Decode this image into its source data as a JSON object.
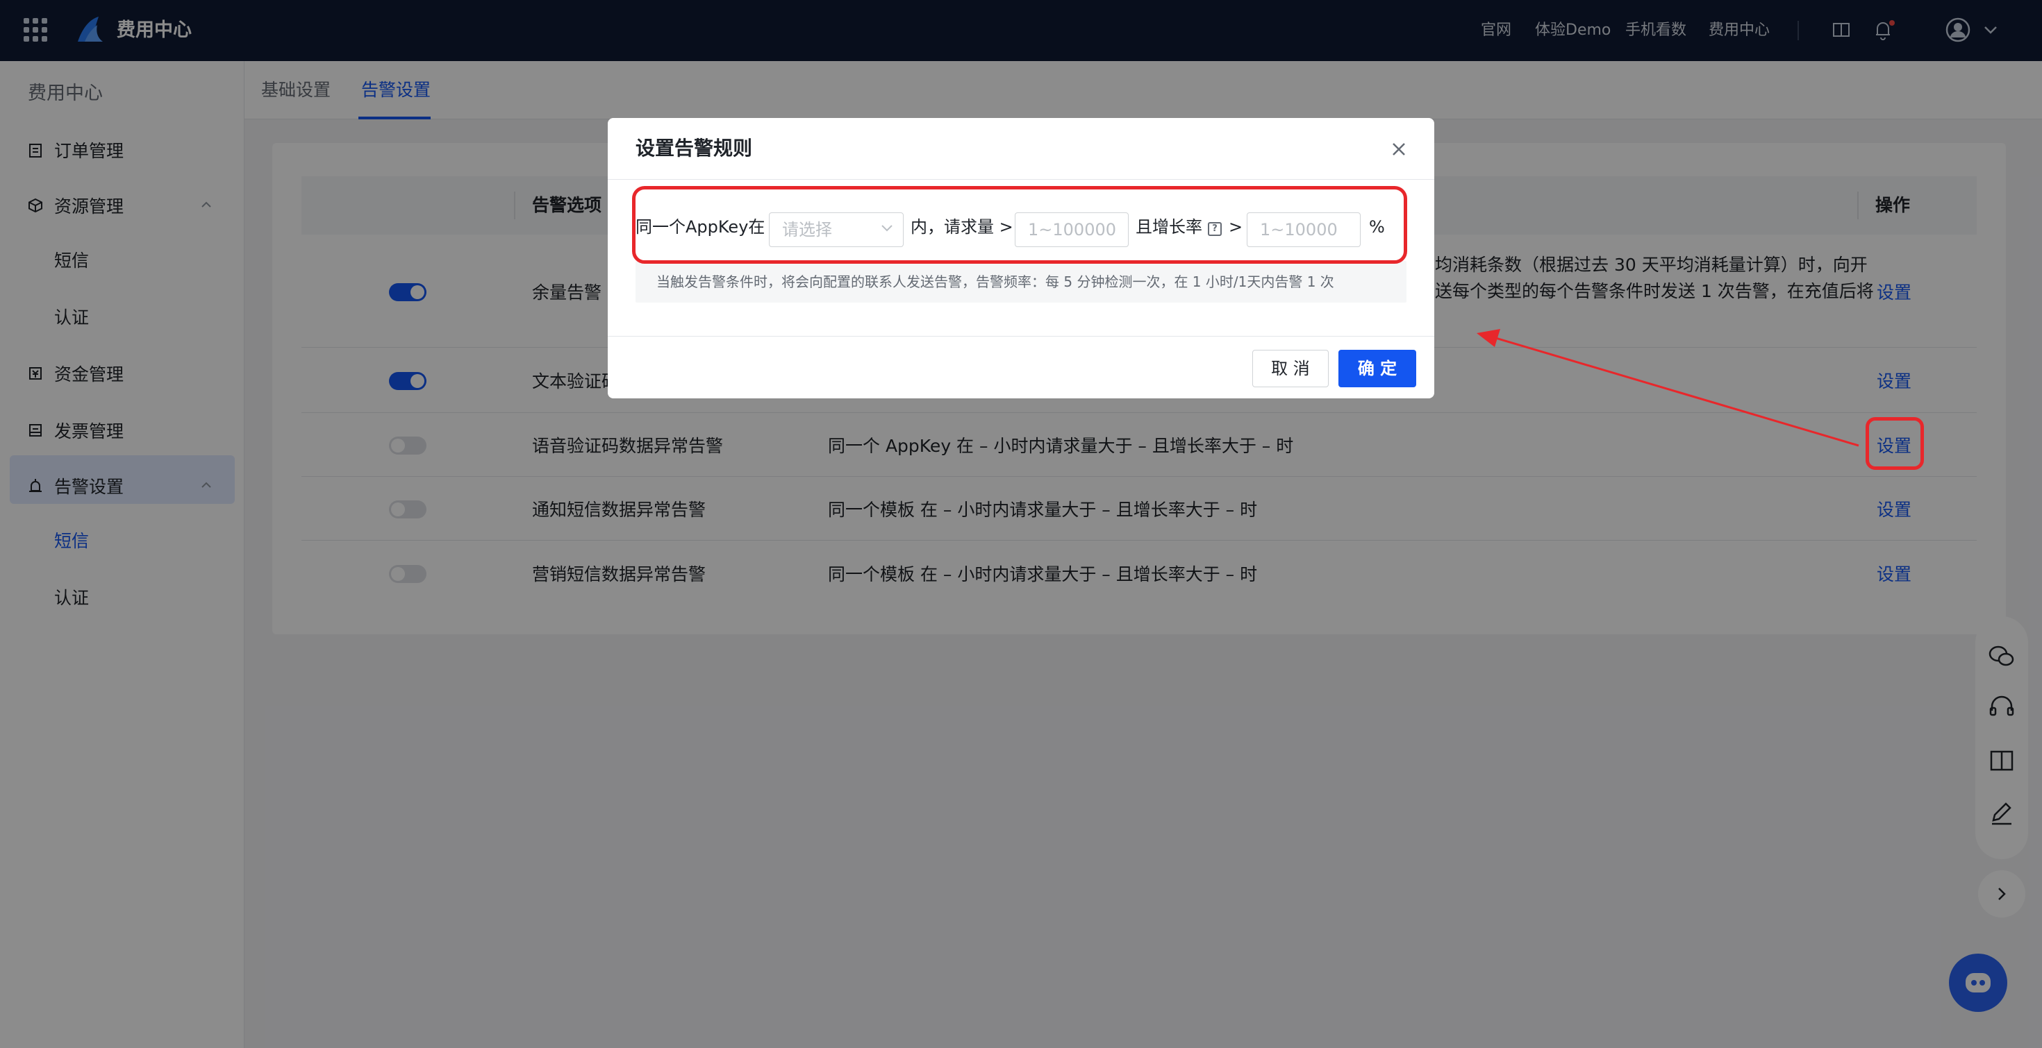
{
  "topbar": {
    "brand": "费用中心",
    "nav": [
      "官网",
      "体验Demo",
      "手机看数",
      "费用中心"
    ]
  },
  "sidebar": {
    "title": "费用中心",
    "items": [
      {
        "label": "订单管理",
        "icon": "clipboard-icon"
      },
      {
        "label": "资源管理",
        "icon": "cube-icon"
      },
      {
        "label": "短信",
        "icon": ""
      },
      {
        "label": "认证",
        "icon": ""
      },
      {
        "label": "资金管理",
        "icon": "wallet-icon"
      },
      {
        "label": "发票管理",
        "icon": "invoice-icon"
      },
      {
        "label": "告警设置",
        "icon": "alarm-icon"
      },
      {
        "label": "短信",
        "icon": ""
      },
      {
        "label": "认证",
        "icon": ""
      }
    ]
  },
  "tabs": [
    "基础设置",
    "告警设置"
  ],
  "table": {
    "headers": {
      "option": "告警选项",
      "action": "操作"
    },
    "rows": [
      {
        "name": "余量告警",
        "desc1": "均消耗条数（根据过去 30 天平均消耗量计算）时，向开",
        "desc2": "送每个类型的每个告警条件时发送 1 次告警，在充值后将",
        "action": "设置",
        "enabled": true
      },
      {
        "name": "文本验证码",
        "desc": "",
        "action": "设置",
        "enabled": true
      },
      {
        "name": "语音验证码数据异常告警",
        "desc": "同一个 AppKey 在 – 小时内请求量大于 – 且增长率大于 – 时",
        "action": "设置",
        "enabled": false
      },
      {
        "name": "通知短信数据异常告警",
        "desc": "同一个模板 在 – 小时内请求量大于 – 且增长率大于 – 时",
        "action": "设置",
        "enabled": false
      },
      {
        "name": "营销短信数据异常告警",
        "desc": "同一个模板 在 – 小时内请求量大于 – 且增长率大于 – 时",
        "action": "设置",
        "enabled": false
      }
    ]
  },
  "modal": {
    "title": "设置告警规则",
    "rule_prefix": "同一个AppKey在",
    "select_placeholder": "请选择",
    "rule_mid": "内，请求量 >",
    "count_placeholder": "1~100000",
    "rule_growth": "且增长率",
    "gt": ">",
    "growth_placeholder": "1~10000",
    "percent": "%",
    "hint": "当触发告警条件时，将会向配置的联系人发送告警，告警频率：每 5 分钟检测一次，在 1 小时/1天内告警 1 次",
    "cancel": "取 消",
    "ok": "确 定"
  },
  "colors": {
    "primary": "#1456f0",
    "topbar": "#0f1a33",
    "annotation": "#e8272b"
  }
}
